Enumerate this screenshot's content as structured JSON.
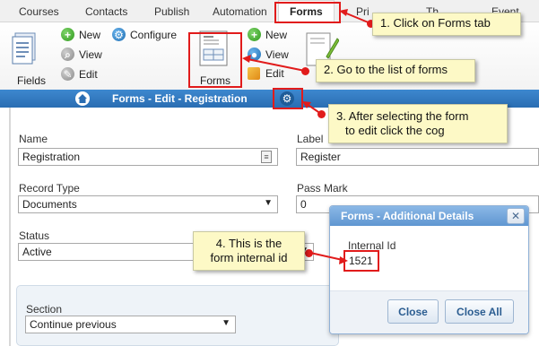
{
  "tabs": [
    {
      "label": "Courses"
    },
    {
      "label": "Contacts"
    },
    {
      "label": "Publish"
    },
    {
      "label": "Automation"
    },
    {
      "label": "Forms"
    },
    {
      "label": "Pri"
    },
    {
      "label": "Th"
    },
    {
      "label": "Event"
    }
  ],
  "ribbon": {
    "fields_label": "Fields",
    "new1": "New",
    "configure": "Configure",
    "view1": "View",
    "edit1": "Edit",
    "forms_label": "Forms",
    "new2": "New",
    "view2": "View",
    "edit2": "Edit"
  },
  "header": {
    "title": "Forms - Edit - Registration"
  },
  "form": {
    "name_label": "Name",
    "name_value": "Registration",
    "label_label": "Label",
    "label_value": "Register",
    "record_type_label": "Record Type",
    "record_type_value": "Documents",
    "pass_mark_label": "Pass Mark",
    "pass_mark_value": "0",
    "status_label": "Status",
    "status_value": "Active",
    "section_label": "Section",
    "section_value": "Continue previous"
  },
  "dialog": {
    "title": "Forms - Additional Details",
    "internal_id_label": "Internal Id",
    "internal_id_value": "1521",
    "close_button": "Close",
    "close_all_button": "Close All"
  },
  "callouts": {
    "c1": "1. Click on Forms tab",
    "c2": "2. Go to the list of forms",
    "c3_line1": "3. After selecting the form",
    "c3_line2": "to edit click the cog",
    "c4_line1": "4. This is the",
    "c4_line2": "form internal id"
  },
  "colors": {
    "header_blue": "#2f76bd",
    "callout_yellow": "#fdf9c6",
    "highlight_red": "#e11b1b",
    "dialog_header": "#6fa3d8"
  }
}
